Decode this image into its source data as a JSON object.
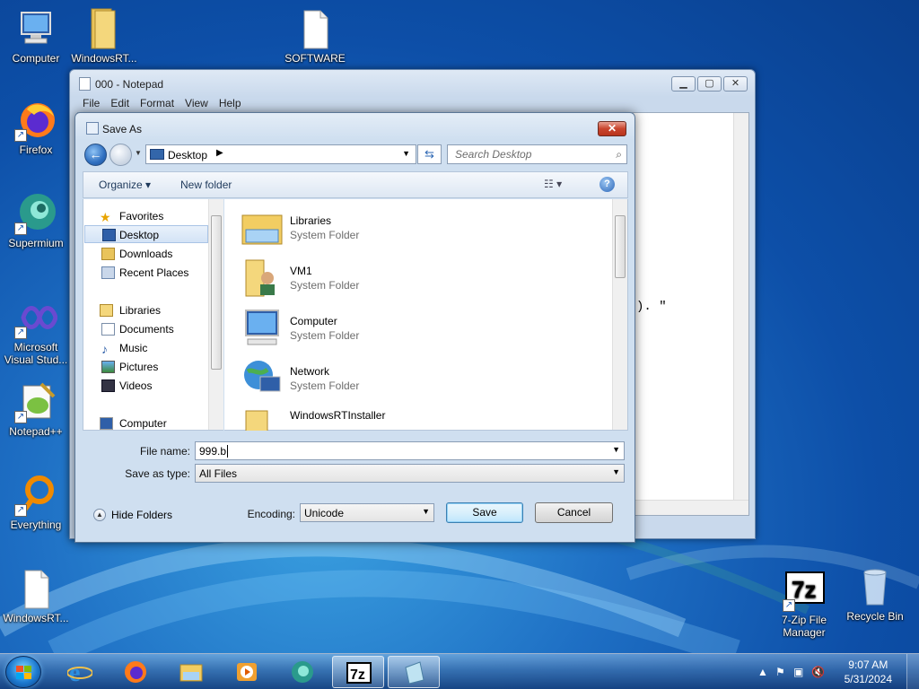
{
  "desktop": {
    "icons": [
      {
        "label": "Computer"
      },
      {
        "label": "WindowsRT..."
      },
      {
        "label": "SOFTWARE"
      },
      {
        "label": "Firefox"
      },
      {
        "label": "Supermium"
      },
      {
        "label": "Microsoft Visual Stud..."
      },
      {
        "label": "Notepad++"
      },
      {
        "label": "Everything"
      },
      {
        "label": "WindowsRT..."
      },
      {
        "label": "7-Zip File Manager"
      },
      {
        "label": "Recycle Bin"
      }
    ]
  },
  "notepad": {
    "title": "000 - Notepad",
    "menu": [
      "File",
      "Edit",
      "Format",
      "View",
      "Help"
    ],
    "visible_text": "). \""
  },
  "dialog": {
    "title": "Save As",
    "address": "Desktop",
    "search_placeholder": "Search Desktop",
    "organize": "Organize",
    "new_folder": "New folder",
    "nav": [
      {
        "label": "Favorites"
      },
      {
        "label": "Desktop"
      },
      {
        "label": "Downloads"
      },
      {
        "label": "Recent Places"
      },
      {
        "label": "Libraries"
      },
      {
        "label": "Documents"
      },
      {
        "label": "Music"
      },
      {
        "label": "Pictures"
      },
      {
        "label": "Videos"
      },
      {
        "label": "Computer"
      }
    ],
    "files": [
      {
        "name": "Libraries",
        "type": "System Folder"
      },
      {
        "name": "VM1",
        "type": "System Folder"
      },
      {
        "name": "Computer",
        "type": "System Folder"
      },
      {
        "name": "Network",
        "type": "System Folder"
      },
      {
        "name": "WindowsRTInstaller",
        "type": ""
      }
    ],
    "file_name_label": "File name:",
    "file_name_value": "999.b",
    "save_type_label": "Save as type:",
    "save_type_value": "All Files",
    "hide_folders": "Hide Folders",
    "encoding_label": "Encoding:",
    "encoding_value": "Unicode",
    "save_button": "Save",
    "cancel_button": "Cancel"
  },
  "taskbar": {
    "time": "9:07 AM",
    "date": "5/31/2024"
  },
  "colors": {
    "desktop_bg": "#1e6fc4",
    "selection": "#d3e3f6",
    "close_red": "#c9452e"
  }
}
